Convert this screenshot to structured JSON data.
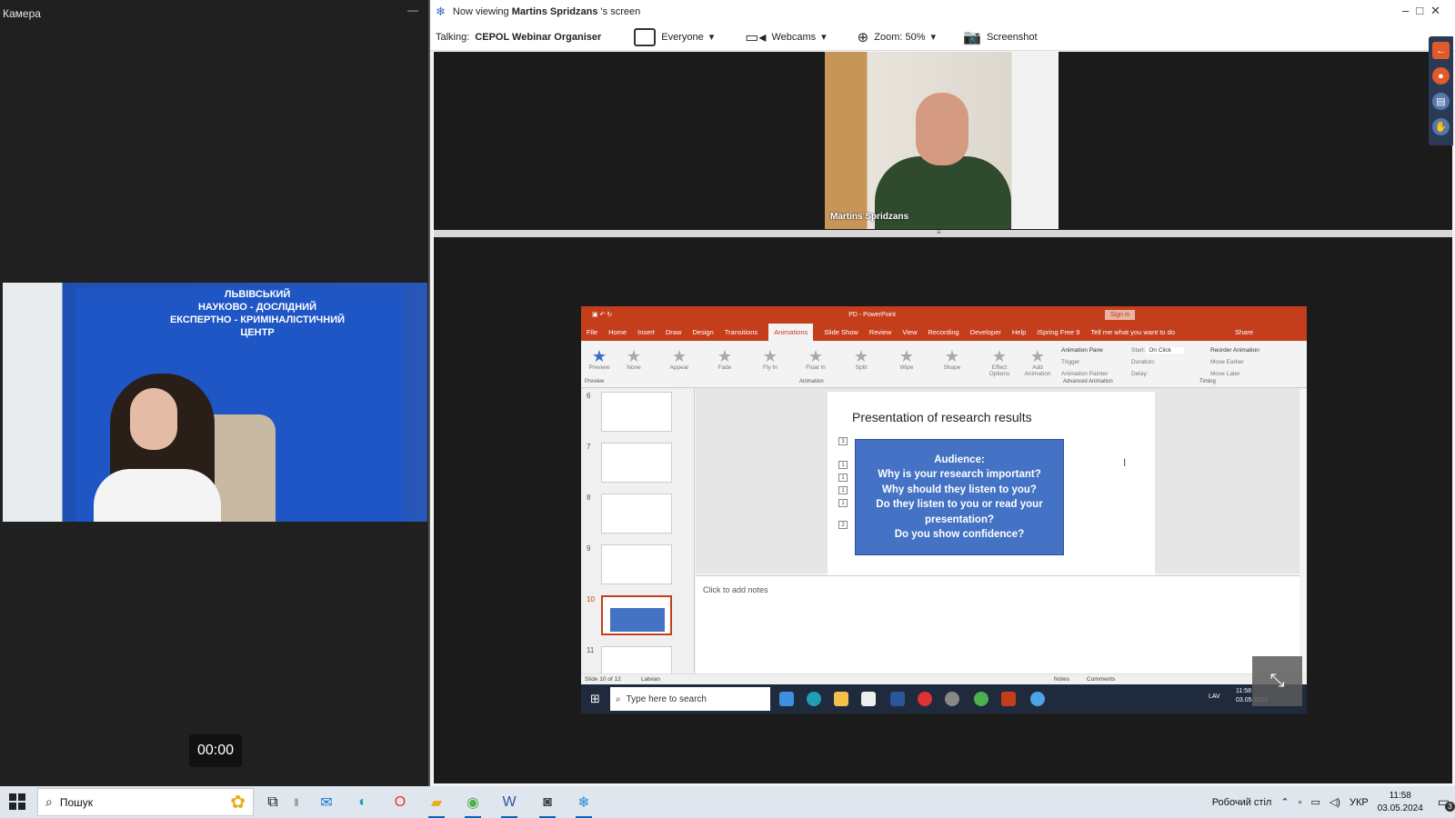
{
  "left_panel": {
    "title": "Камера",
    "timer": "00:00",
    "banner_lines": [
      "ЛЬВІВСЬКИЙ",
      "НАУКОВО - ДОСЛІДНИЙ",
      "ЕКСПЕРТНО - КРИМІНАЛІСТИЧНИЙ ЦЕНТР"
    ]
  },
  "viewer": {
    "title_prefix": "Now viewing",
    "title_name": "Martins Spridzans",
    "title_suffix": "'s screen",
    "toolbar": {
      "talking_label": "Talking:",
      "talking_name": "CEPOL Webinar Organiser",
      "everyone": "Everyone",
      "webcams": "Webcams",
      "zoom": "Zoom: 50%",
      "screenshot": "Screenshot"
    },
    "webcam_name": "Martins Spridzans"
  },
  "ppt": {
    "title": "PD - PowerPoint",
    "sign_in": "Sign in",
    "tabs": [
      "File",
      "Home",
      "Insert",
      "Draw",
      "Design",
      "Transitions",
      "Animations",
      "Slide Show",
      "Review",
      "View",
      "Recording",
      "Developer",
      "Help",
      "iSpring Free 9"
    ],
    "active_tab": "Animations",
    "tell_me": "Tell me what you want to do",
    "share": "Share",
    "animations": [
      "None",
      "Appear",
      "Fade",
      "Fly In",
      "Float In",
      "Split",
      "Wipe",
      "Shape"
    ],
    "ribbon": {
      "preview": "Preview",
      "effect_options": "Effect Options",
      "add_animation": "Add Animation",
      "animation_pane": "Animation Pane",
      "trigger": "Trigger",
      "animation_painter": "Animation Painter",
      "start_label": "Start:",
      "start_value": "On Click",
      "duration": "Duration:",
      "delay": "Delay:",
      "reorder": "Reorder Animation",
      "move_earlier": "Move Earlier",
      "move_later": "Move Later",
      "group_preview": "Preview",
      "group_animation": "Animation",
      "group_advanced": "Advanced Animation",
      "group_timing": "Timing"
    },
    "thumbnail_numbers": [
      "6",
      "7",
      "8",
      "9",
      "10",
      "11"
    ],
    "slide_title": "Presentation of research results",
    "slide_box_lines": [
      "Audience:",
      "Why is your research important?",
      "Why should they listen to you?",
      "Do they listen to you or read your",
      "presentation?",
      "Do you show confidence?"
    ],
    "anim_tags": [
      "1",
      "1",
      "1",
      "1",
      "1",
      "2",
      "3"
    ],
    "notes_placeholder": "Click to add notes",
    "status": {
      "slide_of": "Slide 10 of 12",
      "language": "Latvian",
      "notes": "Notes",
      "comments": "Comments"
    },
    "taskbar_search": "Type here to search",
    "taskbar_lang": "LAV",
    "taskbar_time": "11:58",
    "taskbar_date": "03.05.2024"
  },
  "taskbar": {
    "search_placeholder": "Пошук",
    "desktop_label": "Робочий стіл",
    "lang": "УКР",
    "time": "11:58",
    "date": "03.05.2024",
    "notification_count": "3"
  },
  "colors": {
    "ppt_accent": "#c43e1c",
    "slide_box": "#4472c4",
    "taskbar": "#dfe6ee",
    "viewer_bg": "#1b1b1b"
  }
}
